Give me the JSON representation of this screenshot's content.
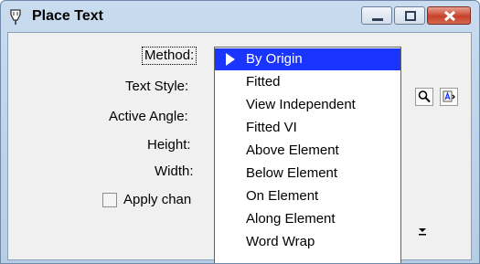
{
  "window": {
    "title": "Place Text"
  },
  "form": {
    "method_label": "Method:",
    "text_style_label": "Text Style:",
    "active_angle_label": "Active Angle:",
    "height_label": "Height:",
    "width_label": "Width:",
    "apply_changes_label": "Apply chan"
  },
  "method_dropdown": {
    "selected": "By Origin",
    "options": [
      "By Origin",
      "Fitted",
      "View Independent",
      "Fitted VI",
      "Above Element",
      "Below Element",
      "On Element",
      "Along Element",
      "Word Wrap"
    ]
  },
  "icons": {
    "app": "pen-nib-icon",
    "minimize": "minimize-icon",
    "maximize": "maximize-icon",
    "close": "close-icon",
    "tool1": "magnifier-icon",
    "tool2": "text-style-icon",
    "dropdown": "chevron-down-icon"
  },
  "colors": {
    "selection": "#1a35ff",
    "close_button": "#c8412a",
    "title_bar": "#c9dcef"
  }
}
